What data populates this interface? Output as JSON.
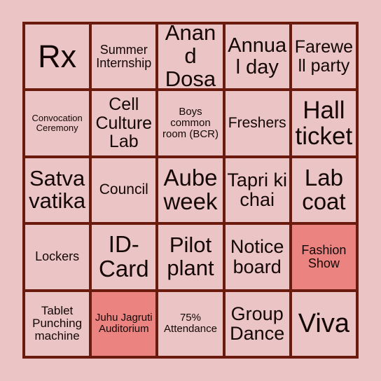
{
  "card": {
    "columns": 5,
    "rows": 5,
    "colors": {
      "background": "#ebc5c6",
      "cell_fill": "#ebc5c6",
      "cell_marked_fill": "#eb8480",
      "grid_line": "#6b1b0e",
      "text": "#140604"
    }
  },
  "cells": [
    {
      "text": "Rx",
      "marked": false,
      "size": "fs-45"
    },
    {
      "text": "Summer Internship",
      "marked": false,
      "size": "fs-18"
    },
    {
      "text": "Anand Dosa",
      "marked": false,
      "size": "fs-31"
    },
    {
      "text": "Annual day",
      "marked": false,
      "size": "fs-29"
    },
    {
      "text": "Farewell party",
      "marked": false,
      "size": "fs-25"
    },
    {
      "text": "Convocation Ceremony",
      "marked": false,
      "size": "fs-13"
    },
    {
      "text": "Cell Culture Lab",
      "marked": false,
      "size": "fs-25"
    },
    {
      "text": "Boys common room (BCR)",
      "marked": false,
      "size": "fs-15"
    },
    {
      "text": "Freshers",
      "marked": false,
      "size": "fs-21"
    },
    {
      "text": "Hall ticket",
      "marked": false,
      "size": "fs-35"
    },
    {
      "text": "Satva vatika",
      "marked": false,
      "size": "fs-31"
    },
    {
      "text": "Council",
      "marked": false,
      "size": "fs-21"
    },
    {
      "text": "Aube week",
      "marked": false,
      "size": "fs-33"
    },
    {
      "text": "Tapri ki chai",
      "marked": false,
      "size": "fs-27"
    },
    {
      "text": "Lab coat",
      "marked": false,
      "size": "fs-33"
    },
    {
      "text": "Lockers",
      "marked": false,
      "size": "fs-18"
    },
    {
      "text": "ID-Card",
      "marked": false,
      "size": "fs-33"
    },
    {
      "text": "Pilot plant",
      "marked": false,
      "size": "fs-31"
    },
    {
      "text": "Notice board",
      "marked": false,
      "size": "fs-27"
    },
    {
      "text": "Fashion Show",
      "marked": true,
      "size": "fs-18"
    },
    {
      "text": "Tablet Punching machine",
      "marked": false,
      "size": "fs-17"
    },
    {
      "text": "Juhu Jagruti Auditorium",
      "marked": true,
      "size": "fs-15"
    },
    {
      "text": "75% Attendance",
      "marked": false,
      "size": "fs-15"
    },
    {
      "text": "Group Dance",
      "marked": false,
      "size": "fs-27"
    },
    {
      "text": "Viva",
      "marked": false,
      "size": "fs-38"
    }
  ]
}
